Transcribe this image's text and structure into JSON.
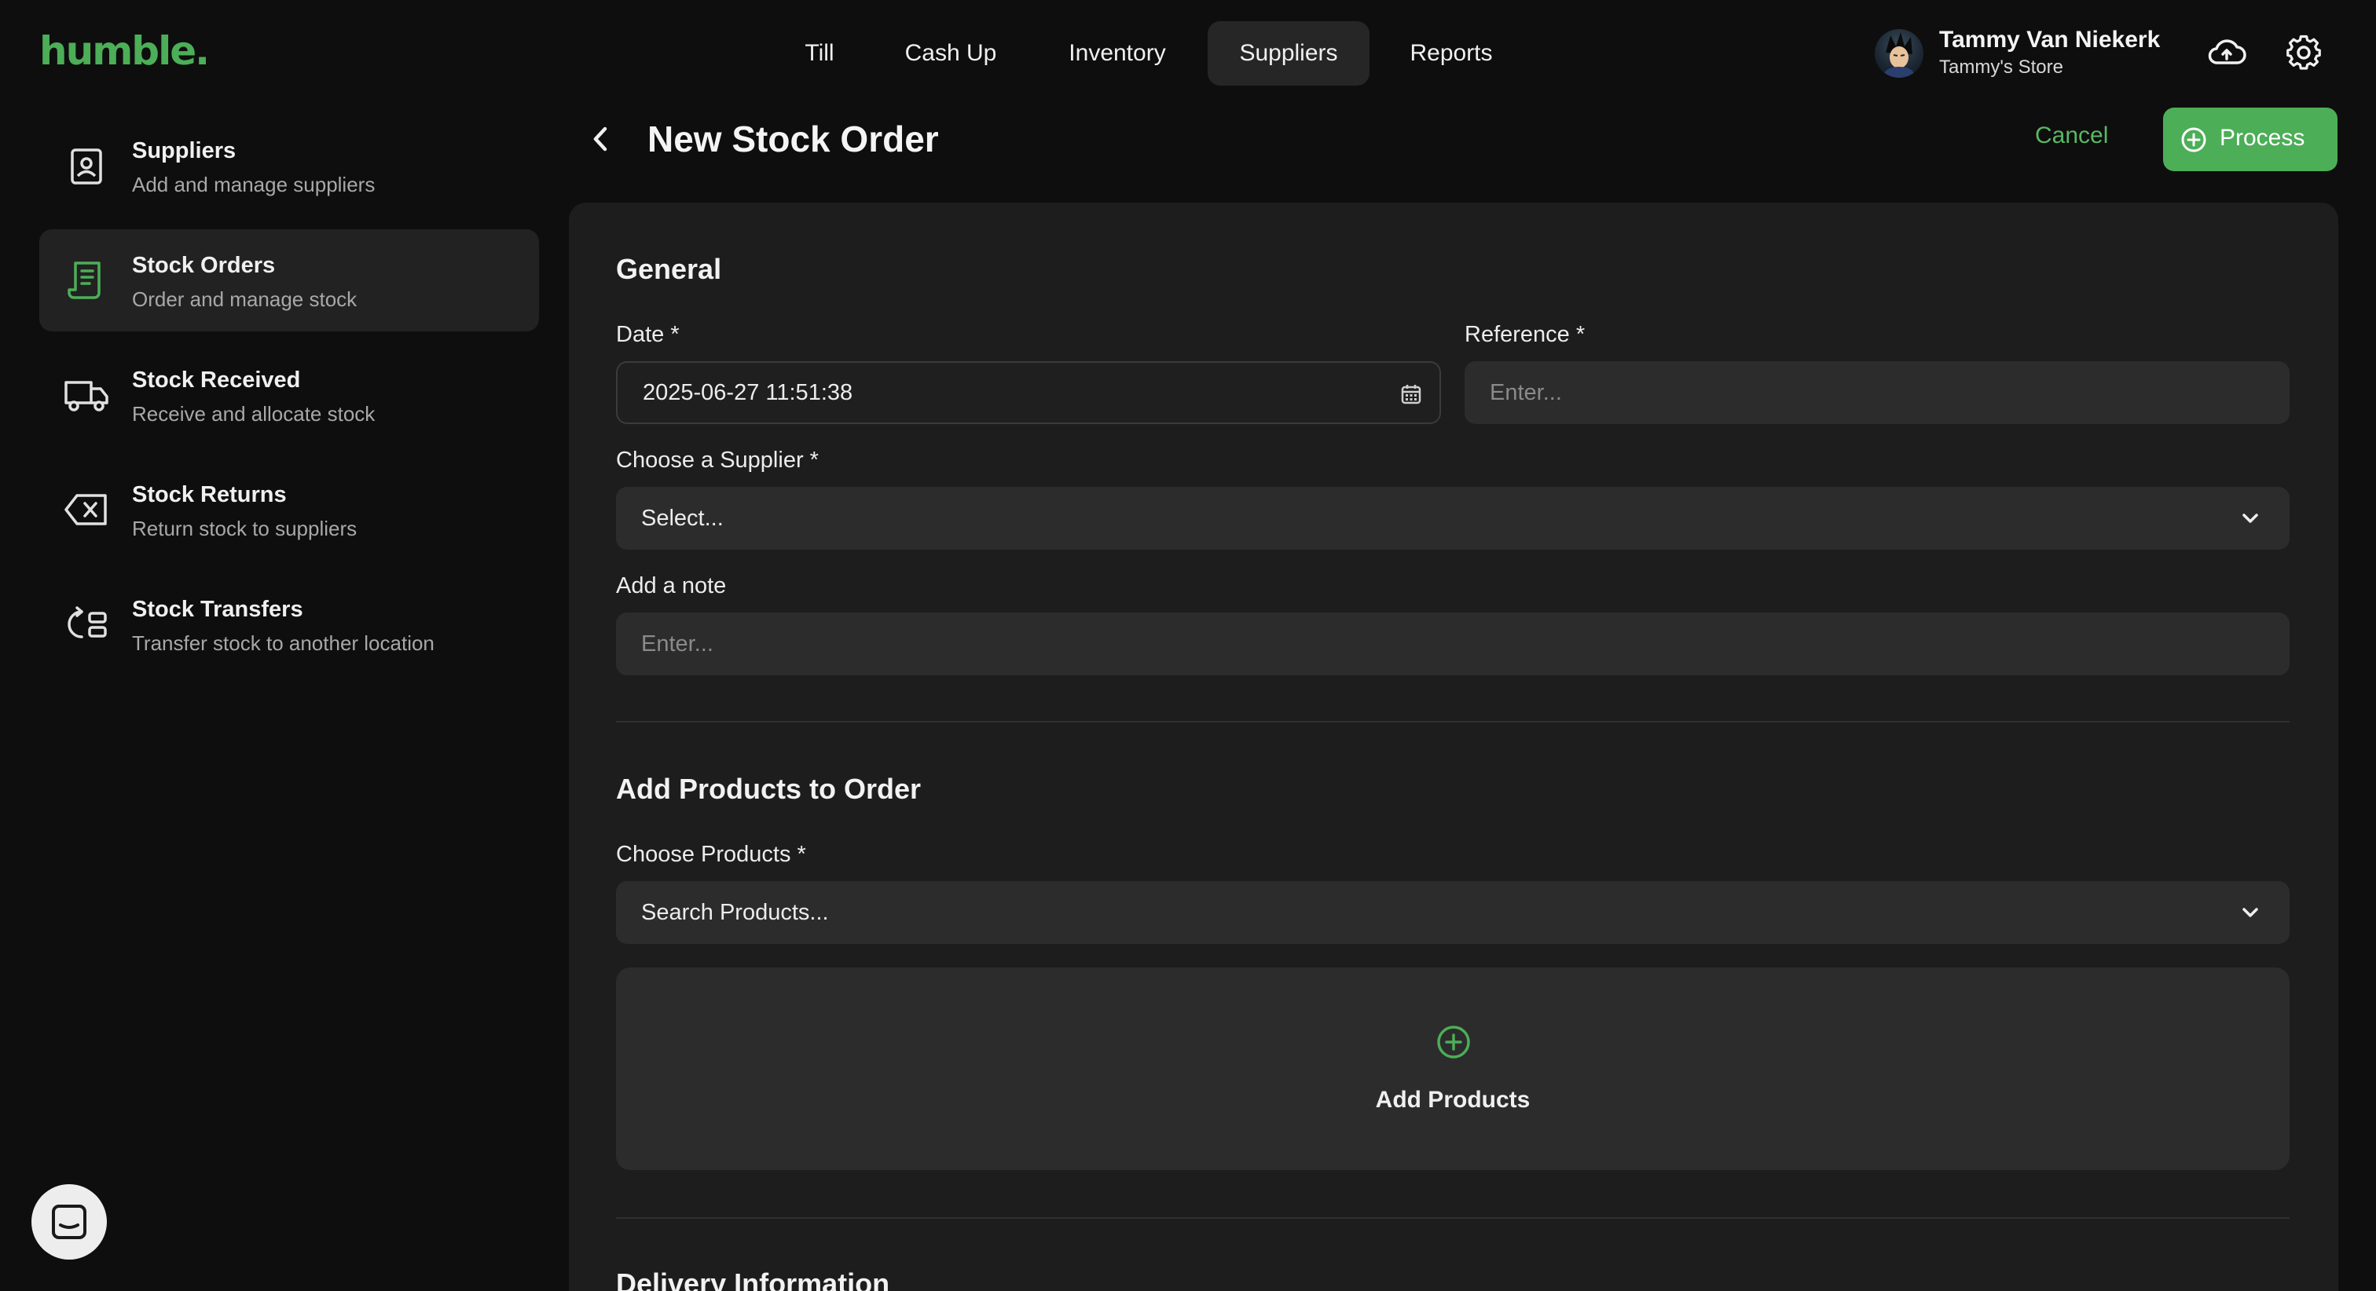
{
  "brand": {
    "logo_text": "humble.",
    "accent_color": "#4cae57"
  },
  "topnav": {
    "items": [
      {
        "label": "Till",
        "active": false
      },
      {
        "label": "Cash Up",
        "active": false
      },
      {
        "label": "Inventory",
        "active": false
      },
      {
        "label": "Suppliers",
        "active": true
      },
      {
        "label": "Reports",
        "active": false
      }
    ]
  },
  "user": {
    "name": "Tammy Van Niekerk",
    "store": "Tammy's Store"
  },
  "header_icons": {
    "sync": "cloud-upload-icon",
    "settings": "gear-icon"
  },
  "sidebar": {
    "items": [
      {
        "title": "Suppliers",
        "subtitle": "Add and manage suppliers",
        "icon": "supplier-badge-icon",
        "active": false
      },
      {
        "title": "Stock Orders",
        "subtitle": "Order and manage stock",
        "icon": "receipt-icon",
        "active": true
      },
      {
        "title": "Stock Received",
        "subtitle": "Receive and allocate stock",
        "icon": "truck-icon",
        "active": false
      },
      {
        "title": "Stock Returns",
        "subtitle": "Return stock to suppliers",
        "icon": "backspace-icon",
        "active": false
      },
      {
        "title": "Stock Transfers",
        "subtitle": "Transfer stock to another location",
        "icon": "transfer-icon",
        "active": false
      }
    ]
  },
  "page": {
    "title": "New Stock Order",
    "cancel_label": "Cancel",
    "process_label": "Process"
  },
  "general": {
    "heading": "General",
    "date_label": "Date *",
    "date_value": "2025-06-27 11:51:38",
    "reference_label": "Reference *",
    "reference_placeholder": "Enter...",
    "supplier_label": "Choose a Supplier *",
    "supplier_placeholder": "Select...",
    "note_label": "Add a note",
    "note_placeholder": "Enter..."
  },
  "products": {
    "heading": "Add Products to Order",
    "choose_label": "Choose Products *",
    "search_placeholder": "Search Products...",
    "add_label": "Add Products"
  },
  "delivery": {
    "heading": "Delivery Information"
  }
}
